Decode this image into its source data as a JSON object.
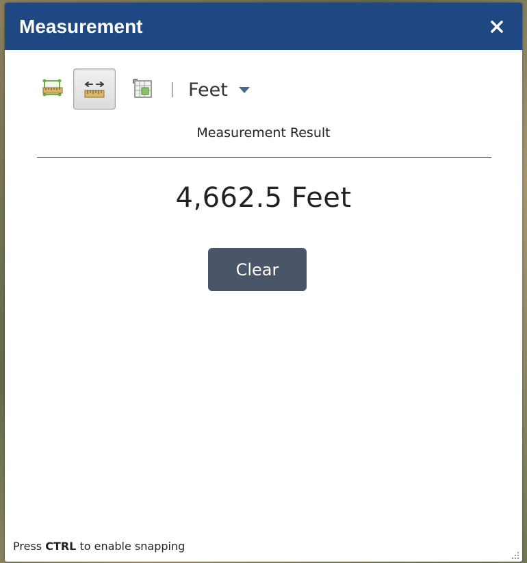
{
  "window": {
    "title": "Measurement",
    "close_icon": "close-icon"
  },
  "toolbar": {
    "tools": [
      {
        "name": "area-tool",
        "icon": "area-measure-icon",
        "active": false
      },
      {
        "name": "distance-tool",
        "icon": "distance-measure-icon",
        "active": true
      },
      {
        "name": "location-tool",
        "icon": "location-measure-icon",
        "active": false
      }
    ],
    "unit": {
      "selected": "Feet",
      "icon": "chevron-down-icon"
    }
  },
  "result": {
    "heading": "Measurement Result",
    "value": "4,662.5 Feet"
  },
  "actions": {
    "clear_label": "Clear"
  },
  "footer": {
    "hint_prefix": "Press ",
    "hint_key": "CTRL",
    "hint_suffix": " to enable snapping"
  },
  "colors": {
    "titlebar": "#1f4883",
    "button": "#4a5568",
    "tool_green": "#6fae46"
  }
}
